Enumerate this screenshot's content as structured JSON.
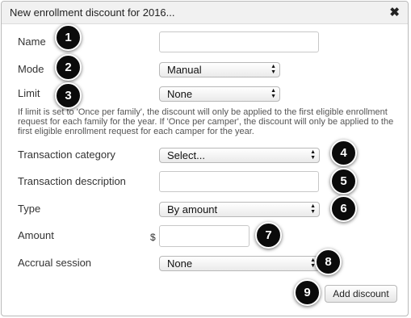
{
  "dialog": {
    "title": "New enrollment discount for 2016...",
    "close_glyph": "✖"
  },
  "form": {
    "name": {
      "label": "Name",
      "value": ""
    },
    "mode": {
      "label": "Mode",
      "selected": "Manual"
    },
    "limit": {
      "label": "Limit",
      "selected": "None"
    },
    "help_text": "If limit is set to 'Once per family', the discount will only be applied to the first eligible enrollment request for each family for the year. If 'Once per camper', the discount will only be applied to the first eligible enrollment request for each camper for the year.",
    "transaction_category": {
      "label": "Transaction category",
      "selected": "Select..."
    },
    "transaction_description": {
      "label": "Transaction description",
      "value": ""
    },
    "type": {
      "label": "Type",
      "selected": "By amount"
    },
    "amount": {
      "label": "Amount",
      "currency_symbol": "$",
      "value": ""
    },
    "accrual_session": {
      "label": "Accrual session",
      "selected": "None"
    }
  },
  "actions": {
    "add_discount_label": "Add discount"
  },
  "callouts": [
    "1",
    "2",
    "3",
    "4",
    "5",
    "6",
    "7",
    "8",
    "9"
  ],
  "icons": {
    "close": "close-icon",
    "select_arrows": "updown-arrows-icon"
  }
}
